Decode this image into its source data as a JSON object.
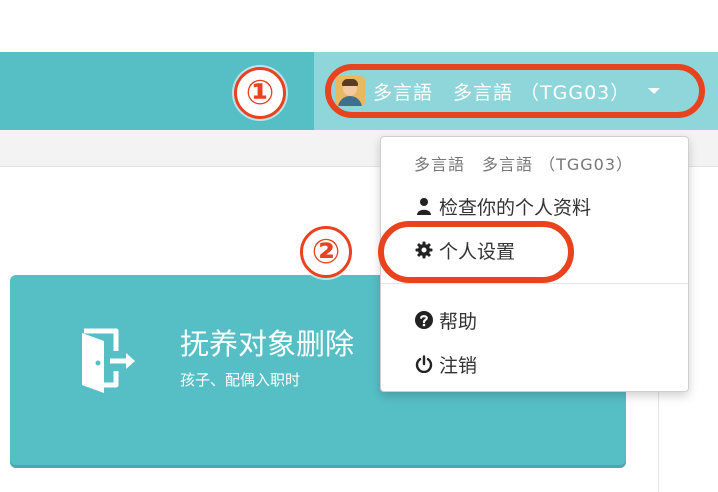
{
  "header": {
    "user_display": "多言語　多言語 （TGG03）",
    "avatar_icon": "user-avatar-icon",
    "caret_icon": "caret-down-icon",
    "bar_color": "#56bfc6",
    "highlight_color": "#e8421f"
  },
  "annotations": {
    "step1": "①",
    "step2": "②"
  },
  "card": {
    "icon": "exit-door-icon",
    "title": "抚养对象删除",
    "subtitle": "孩子、配偶入职时"
  },
  "dropdown": {
    "header": "多言語　多言語 （TGG03）",
    "items": [
      {
        "icon": "user-icon",
        "label": "检查你的个人资料"
      },
      {
        "icon": "gear-icon",
        "label": "个人设置"
      },
      {
        "icon": "question-circle-icon",
        "label": "帮助"
      },
      {
        "icon": "power-icon",
        "label": "注销"
      }
    ]
  }
}
